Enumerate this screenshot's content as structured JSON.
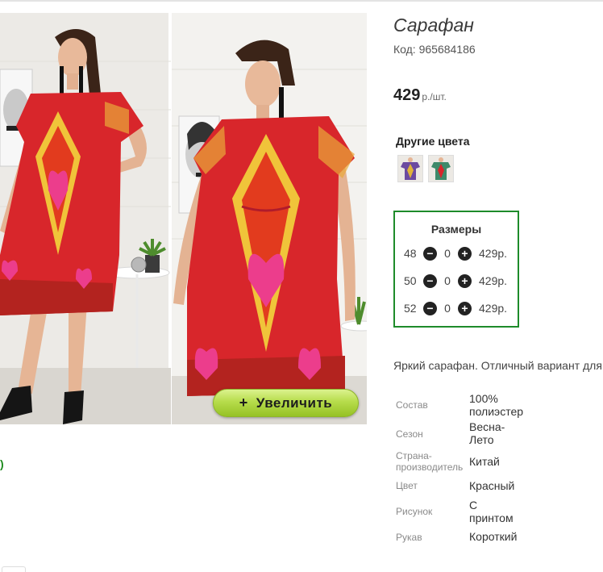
{
  "product": {
    "title": "Сарафан",
    "code": "Код: 965684186",
    "price": "429",
    "price_unit": "р./шт.",
    "zoom_label": "Увеличить",
    "zoom_icon": "+",
    "partial_green_text": ")"
  },
  "other_colors": {
    "title": "Другие цвета",
    "swatches": [
      "color-variant-1",
      "color-variant-2"
    ]
  },
  "sizes": {
    "title": "Размеры",
    "rows": [
      {
        "size": "48",
        "qty": "0",
        "price": "429р."
      },
      {
        "size": "50",
        "qty": "0",
        "price": "429р."
      },
      {
        "size": "52",
        "qty": "0",
        "price": "429р."
      }
    ]
  },
  "description": "Яркий сарафан. Отличный вариант для",
  "specs": [
    {
      "label": "Состав",
      "value_lines": [
        "100%",
        "полиэстер"
      ]
    },
    {
      "label": "Сезон",
      "value_lines": [
        "Весна-",
        "Лето"
      ]
    },
    {
      "label": "Страна-производитель",
      "label_lines": [
        "Страна-",
        "производитель"
      ],
      "value_lines": [
        "Китай"
      ]
    },
    {
      "label": "Цвет",
      "value_lines": [
        "Красный"
      ]
    },
    {
      "label": "Рисунок",
      "value_lines": [
        "С",
        "принтом"
      ]
    },
    {
      "label": "Рукав",
      "value_lines": [
        "Короткий"
      ]
    }
  ],
  "colors": {
    "accent_green": "#1e8b2a",
    "button_green": "#b6dc4b",
    "dress_red": "#d8262b"
  }
}
